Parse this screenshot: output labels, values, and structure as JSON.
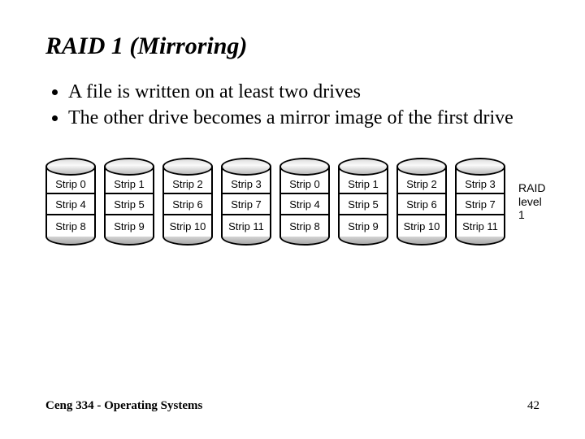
{
  "title": "RAID 1 (Mirroring)",
  "bullets": [
    "A file is written on at least two drives",
    "The other drive becomes a mirror image of the first drive"
  ],
  "disks": {
    "group1": [
      [
        "Strip 0",
        "Strip 4",
        "Strip 8"
      ],
      [
        "Strip 1",
        "Strip 5",
        "Strip 9"
      ],
      [
        "Strip 2",
        "Strip 6",
        "Strip 10"
      ],
      [
        "Strip 3",
        "Strip 7",
        "Strip 11"
      ]
    ],
    "group2": [
      [
        "Strip 0",
        "Strip 4",
        "Strip 8"
      ],
      [
        "Strip 1",
        "Strip 5",
        "Strip 9"
      ],
      [
        "Strip 2",
        "Strip 6",
        "Strip 10"
      ],
      [
        "Strip 3",
        "Strip 7",
        "Strip 11"
      ]
    ]
  },
  "figure_caption_line1": "RAID",
  "figure_caption_line2": "level 1",
  "footer_left": "Ceng 334 - Operating Systems",
  "footer_right": "42"
}
